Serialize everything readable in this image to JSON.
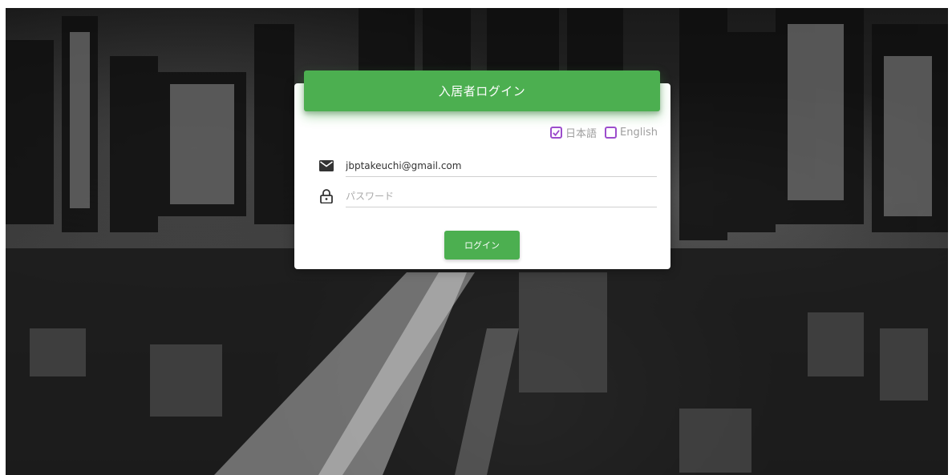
{
  "login": {
    "title": "入居者ログイン",
    "languages": [
      {
        "label": "日本語",
        "checked": true
      },
      {
        "label": "English",
        "checked": false
      }
    ],
    "email": {
      "value": "jbptakeuchi@gmail.com",
      "placeholder": ""
    },
    "password": {
      "value": "",
      "placeholder": "パスワード"
    },
    "submit_label": "ログイン"
  },
  "icons": {
    "email": "mail-icon",
    "password": "lock-icon",
    "check": "check-icon"
  },
  "colors": {
    "accent": "#4caf50",
    "checkbox": "#9c4dcc"
  }
}
